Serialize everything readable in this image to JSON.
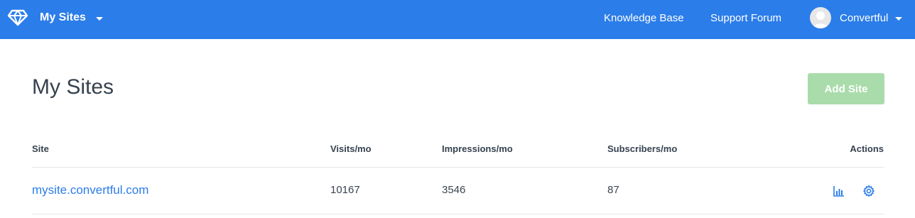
{
  "header": {
    "title": "My Sites",
    "nav": [
      {
        "label": "Knowledge Base"
      },
      {
        "label": "Support Forum"
      }
    ],
    "user": {
      "name": "Convertful"
    }
  },
  "page": {
    "title": "My Sites",
    "add_button": "Add Site"
  },
  "table": {
    "columns": [
      "Site",
      "Visits/mo",
      "Impressions/mo",
      "Subscribers/mo",
      "Actions"
    ],
    "rows": [
      {
        "site": "mysite.convertful.com",
        "visits": "10167",
        "impressions": "3546",
        "subscribers": "87"
      }
    ]
  },
  "colors": {
    "header_bg": "#2b7de9",
    "link": "#2b7de9",
    "add_button_bg": "#a9dcaa"
  },
  "icons": {
    "logo": "diamond-logo-icon",
    "stats": "bar-chart-icon",
    "settings": "gear-icon"
  }
}
